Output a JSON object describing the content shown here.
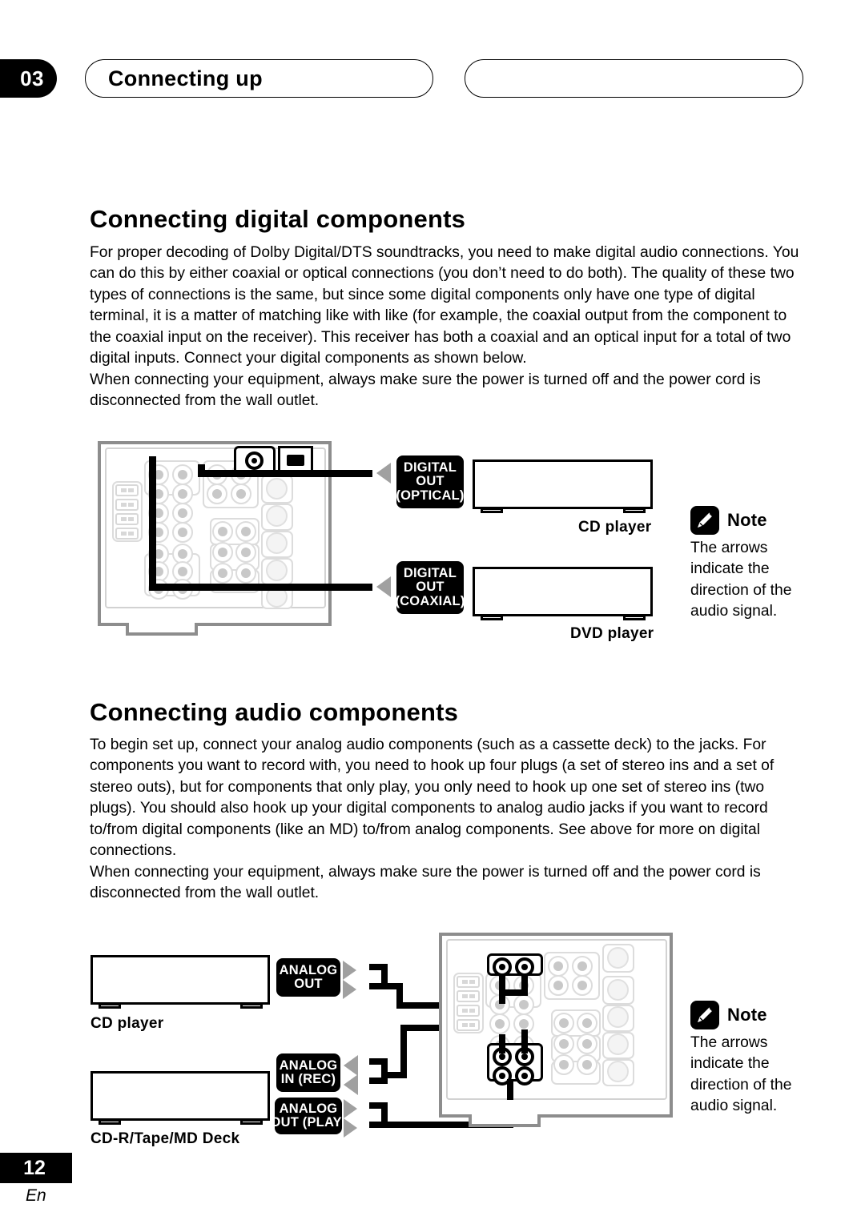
{
  "header": {
    "chapter_number": "03",
    "chapter_title": "Connecting up",
    "right_pill_text": ""
  },
  "sections": [
    {
      "heading": "Connecting digital components",
      "paragraphs": [
        "For proper decoding of Dolby Digital/DTS soundtracks, you need to make digital audio connections. You can do this by either coaxial or optical connections (you don’t need to do both). The quality of these two types of connections is the same, but since some digital components only have one type of digital terminal, it is a matter of matching like with like (for example, the coaxial output from the component to the coaxial input on the receiver). This receiver has both a coaxial and an optical input for a total of two digital inputs. Connect your digital components as shown below.",
        "When connecting your equipment, always make sure the power is turned off and the power cord is disconnected from the wall outlet."
      ]
    },
    {
      "heading": "Connecting audio components",
      "paragraphs": [
        "To begin set up, connect your analog audio components (such as a cassette deck) to the jacks. For components you want to record with, you need to hook up four plugs (a set of stereo ins and a set of stereo outs), but for components that only play, you only need to hook up one set of stereo ins (two plugs). You should also hook up your digital components to analog audio jacks if you want to record to/from digital components (like an MD) to/from analog components. See above for more on digital connections.",
        "When connecting your equipment, always make sure the power is turned off and the power cord is disconnected from the wall outlet."
      ]
    }
  ],
  "diagram_digital": {
    "tags": [
      {
        "lines": [
          "DIGITAL",
          "OUT",
          "(OPTICAL)"
        ]
      },
      {
        "lines": [
          "DIGITAL",
          "OUT",
          "(COAXIAL)"
        ]
      }
    ],
    "components": [
      {
        "label": "CD player"
      },
      {
        "label": "DVD player"
      }
    ],
    "note": {
      "title": "Note",
      "icon": "pencil-icon",
      "text": "The arrows indicate the direction of the audio signal."
    }
  },
  "diagram_audio": {
    "tags": [
      {
        "lines": [
          "ANALOG",
          "OUT"
        ]
      },
      {
        "lines": [
          "ANALOG",
          "IN (REC)"
        ]
      },
      {
        "lines": [
          "ANALOG",
          "OUT (PLAY)"
        ]
      }
    ],
    "components": [
      {
        "label": "CD player"
      },
      {
        "label": "CD-R/Tape/MD Deck"
      }
    ],
    "note": {
      "title": "Note",
      "icon": "pencil-icon",
      "text": "The arrows indicate the direction of the audio signal."
    }
  },
  "footer": {
    "page_number": "12",
    "language": "En"
  },
  "colors": {
    "ink": "#000000",
    "arrow_gray": "#a0a0a0",
    "panel_gray": "#8d8d8d",
    "faint_gray": "#d8d8d8"
  }
}
